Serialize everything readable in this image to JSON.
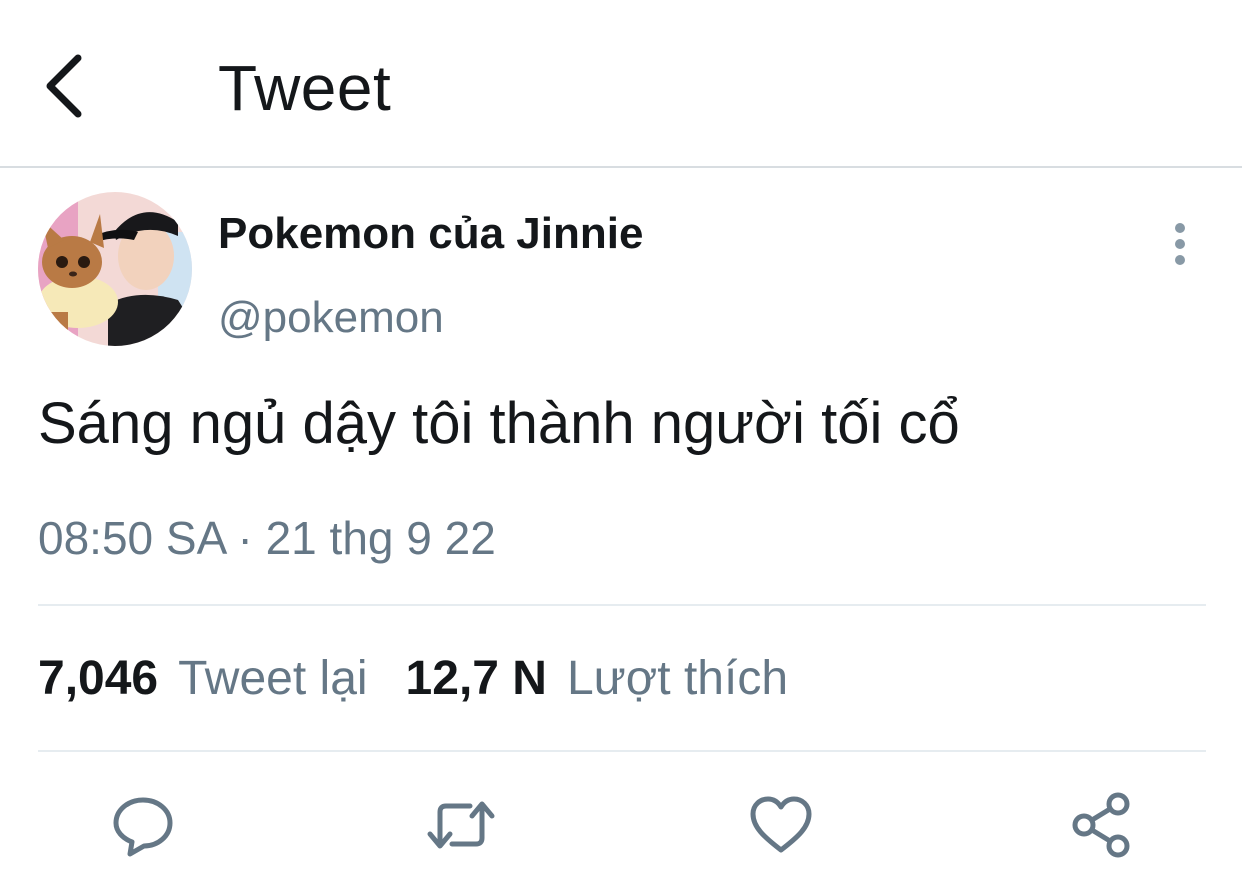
{
  "header": {
    "title": "Tweet",
    "back_icon": "chevron-left-icon"
  },
  "tweet": {
    "author": {
      "display_name": "Pokemon của Jinnie",
      "handle": "@pokemon"
    },
    "text": "Sáng ngủ dậy tôi thành người tối cổ",
    "timestamp": "08:50 SA · 21 thg 9 22",
    "stats": {
      "retweets_count": "7,046",
      "retweets_label": "Tweet lại",
      "likes_count": "12,7 N",
      "likes_label": "Lượt thích"
    },
    "actions": [
      "reply-icon",
      "retweet-icon",
      "like-icon",
      "share-icon"
    ]
  },
  "colors": {
    "text_primary": "#14171a",
    "text_secondary": "#657786",
    "divider": "#e6ecf0"
  }
}
